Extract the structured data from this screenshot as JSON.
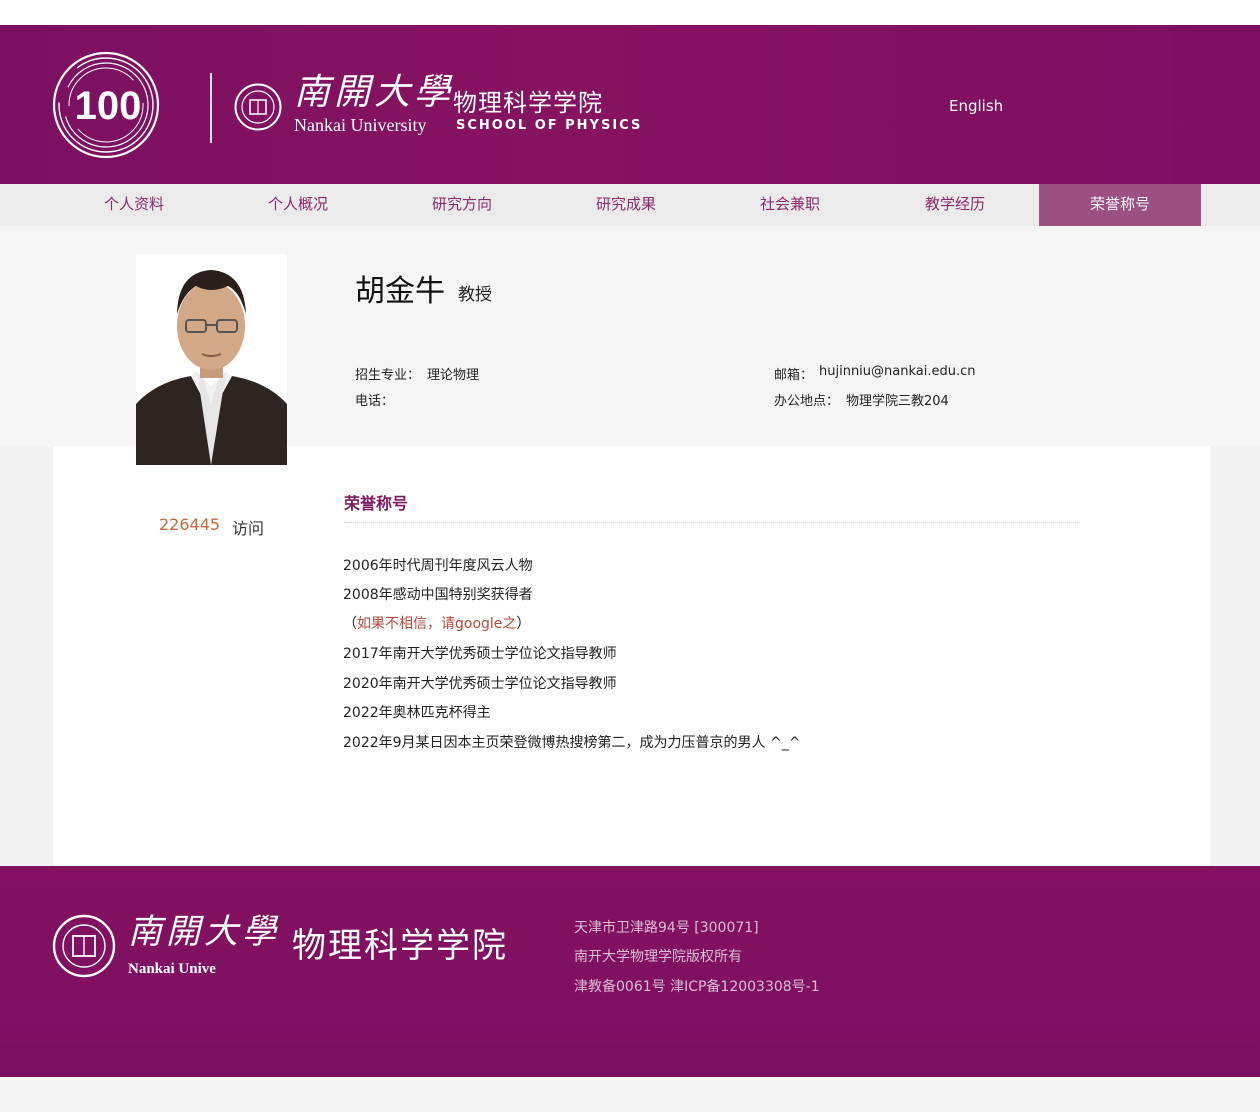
{
  "header": {
    "logo_100": "100",
    "university_cn": "南開大學",
    "university_en": "Nankai University",
    "school_cn": "物理科学学院",
    "school_en": "SCHOOL OF PHYSICS",
    "english_link": "English",
    "brand_color": "#7c0f63"
  },
  "nav": {
    "items": [
      {
        "label": "个人资料"
      },
      {
        "label": "个人概况"
      },
      {
        "label": "研究方向"
      },
      {
        "label": "研究成果"
      },
      {
        "label": "社会兼职"
      },
      {
        "label": "教学经历"
      },
      {
        "label": "荣誉称号",
        "active": true
      }
    ]
  },
  "profile": {
    "name": "胡金牛",
    "title": "教授",
    "major_label": "招生专业：",
    "major_value": "理论物理",
    "phone_label": "电话：",
    "phone_value": "",
    "email_label": "邮箱：",
    "email_value": "hujinniu@nankai.edu.cn",
    "office_label": "办公地点：",
    "office_value": "物理学院三教204"
  },
  "visits": {
    "count": "226445",
    "label": "访问"
  },
  "honors": {
    "section_title": "荣誉称号",
    "items": [
      {
        "text": "2006年时代周刊年度风云人物"
      },
      {
        "text": "2008年感动中国特别奖获得者"
      },
      {
        "pre": "（",
        "red": "如果不相信，请google之",
        "post": "）"
      },
      {
        "text": "2017年南开大学优秀硕士学位论文指导教师"
      },
      {
        "text": "2020年南开大学优秀硕士学位论文指导教师"
      },
      {
        "text": "2022年奥林匹克杯得主"
      },
      {
        "text": "2022年9月某日因本主页荣登微博热搜榜第二，成为力压普京的男人 ^_^"
      }
    ]
  },
  "footer": {
    "university_cn": "南開大學",
    "university_en": "Nankai Unive",
    "school_cn": "物理科学学院",
    "address": "天津市卫津路94号 [300071]",
    "copyright": "南开大学物理学院版权所有",
    "icp": "津教备0061号 津ICP备12003308号-1"
  }
}
